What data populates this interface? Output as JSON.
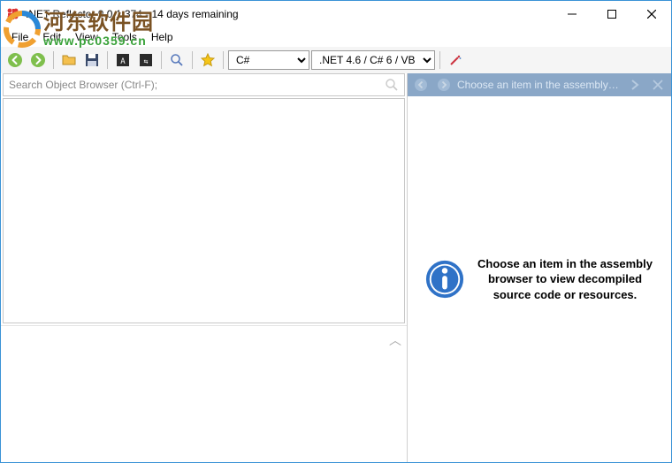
{
  "titlebar": {
    "title": ".NET Reflector 9.0.1.374 - 14 days remaining"
  },
  "menubar": {
    "items": [
      "File",
      "Edit",
      "View",
      "Tools",
      "Help"
    ]
  },
  "toolbar": {
    "back_icon": "back-icon",
    "forward_icon": "forward-icon",
    "open_icon": "open-folder-icon",
    "save_icon": "save-icon",
    "code1_icon": "asm-c-icon",
    "code2_icon": "asm-vb-icon",
    "search_icon": "search-icon",
    "star_icon": "favorite-icon",
    "language_selected": "C#",
    "framework_selected": ".NET 4.6 / C# 6 / VB",
    "wand_icon": "wand-icon"
  },
  "left": {
    "search_placeholder": "Search Object Browser (Ctrl-F);"
  },
  "right": {
    "header_text": "Choose an item in the assembly browser to view...",
    "hint_text": "Choose an item in the assembly browser to view decompiled source code or resources."
  },
  "watermark": {
    "line1": "河东软件园",
    "line2": "www.pc0359.cn"
  }
}
